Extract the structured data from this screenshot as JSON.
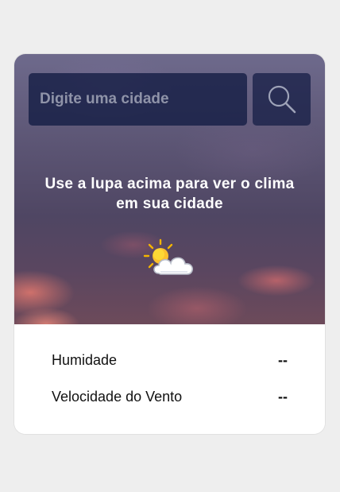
{
  "search": {
    "placeholder": "Digite uma cidade",
    "value": ""
  },
  "search_button": {
    "icon": "search-icon"
  },
  "message": "Use a lupa acima para ver o clima em sua cidade",
  "weather_icon": "sun-behind-cloud-icon",
  "details": {
    "humidity_label": "Humidade",
    "humidity_value": "--",
    "wind_label": "Velocidade do Vento",
    "wind_value": "--"
  },
  "colors": {
    "page_background": "#eeeeee",
    "search_background": "#161e46",
    "text_light": "#ffffff",
    "text_dark": "#111111"
  }
}
